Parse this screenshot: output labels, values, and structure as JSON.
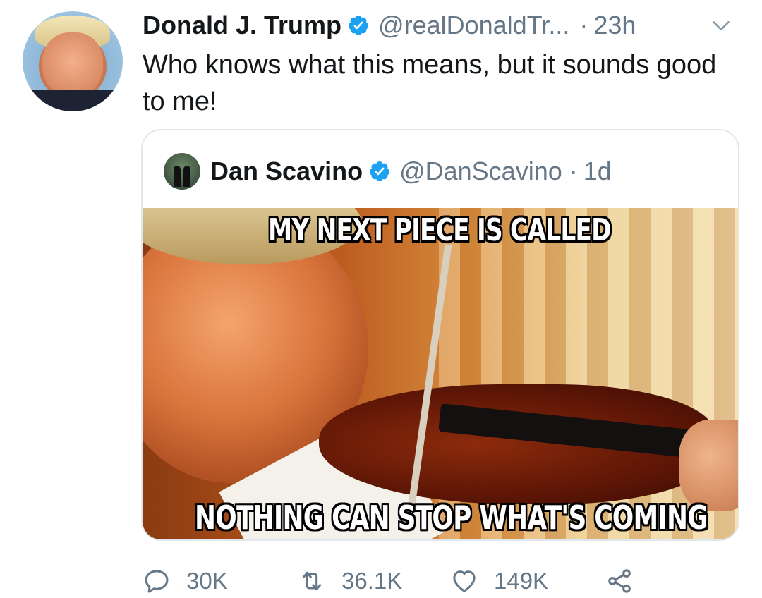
{
  "tweet": {
    "author_name": "Donald J. Trump",
    "author_handle": "@realDonaldTr...",
    "time": "23h",
    "separator": "·",
    "text": "Who knows what this means, but it sounds good to me!"
  },
  "quoted_tweet": {
    "author_name": "Dan Scavino",
    "author_handle": "@DanScavino",
    "separator": "·",
    "time": "1d",
    "meme_top_caption": "MY NEXT PIECE IS CALLED",
    "meme_bottom_caption": "NOTHING CAN STOP WHAT'S COMING"
  },
  "actions": {
    "reply_count": "30K",
    "retweet_count": "36.1K",
    "like_count": "149K"
  },
  "colors": {
    "text": "#14171a",
    "secondary": "#657786",
    "verified_badge": "#1da1f2",
    "border": "#e1e8ed"
  },
  "icons": [
    "verified-badge-icon",
    "chevron-down-icon",
    "reply-icon",
    "retweet-icon",
    "like-icon",
    "share-icon"
  ]
}
